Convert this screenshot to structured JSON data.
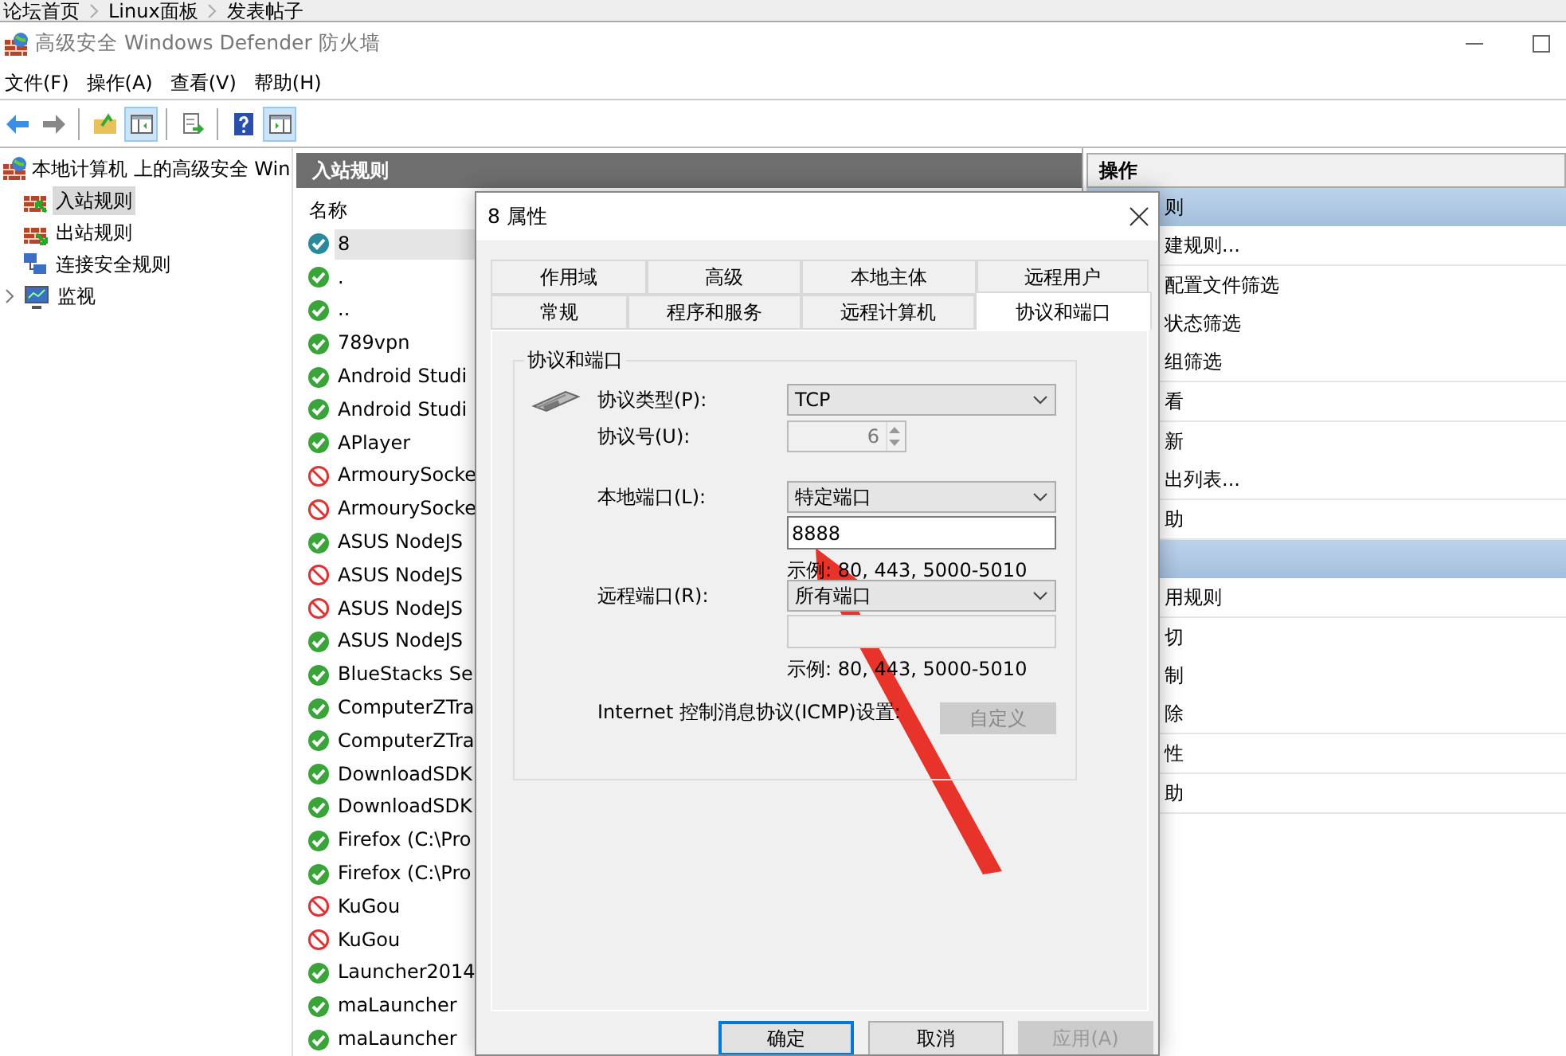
{
  "breadcrumb": [
    "论坛首页",
    "Linux面板",
    "发表帖子"
  ],
  "window": {
    "title": "高级安全 Windows Defender 防火墙"
  },
  "menu": [
    "文件(F)",
    "操作(A)",
    "查看(V)",
    "帮助(H)"
  ],
  "toolbar": [
    {
      "kind": "back",
      "pressed": false
    },
    {
      "kind": "forward",
      "pressed": false
    },
    {
      "kind": "sep"
    },
    {
      "kind": "up",
      "pressed": false
    },
    {
      "kind": "tree",
      "pressed": true
    },
    {
      "kind": "sep"
    },
    {
      "kind": "export",
      "pressed": false
    },
    {
      "kind": "sep"
    },
    {
      "kind": "help",
      "pressed": false
    },
    {
      "kind": "pane",
      "pressed": true
    }
  ],
  "tree": {
    "label": "本地计算机 上的高级安全 Win",
    "children": [
      {
        "label": "入站规则",
        "kind": "inbound",
        "selected": true
      },
      {
        "label": "出站规则",
        "kind": "outbound",
        "selected": false
      },
      {
        "label": "连接安全规则",
        "kind": "connection",
        "selected": false
      },
      {
        "label": "监视",
        "kind": "monitor",
        "selected": false,
        "expandable": true
      }
    ]
  },
  "rules_panel": {
    "title": "入站规则",
    "column": "名称",
    "rows": [
      {
        "name": "8",
        "kind": "allow",
        "selected": true
      },
      {
        "name": ".",
        "kind": "allow",
        "selected": false
      },
      {
        "name": "..",
        "kind": "allow",
        "selected": false
      },
      {
        "name": "789vpn",
        "kind": "allow",
        "selected": false
      },
      {
        "name": "Android Studi",
        "kind": "allow",
        "selected": false
      },
      {
        "name": "Android Studi",
        "kind": "allow",
        "selected": false
      },
      {
        "name": "APlayer",
        "kind": "allow",
        "selected": false
      },
      {
        "name": "ArmourySocke",
        "kind": "block",
        "selected": false
      },
      {
        "name": "ArmourySocke",
        "kind": "block",
        "selected": false
      },
      {
        "name": "ASUS NodeJS",
        "kind": "allow",
        "selected": false
      },
      {
        "name": "ASUS NodeJS",
        "kind": "block",
        "selected": false
      },
      {
        "name": "ASUS NodeJS",
        "kind": "block",
        "selected": false
      },
      {
        "name": "ASUS NodeJS",
        "kind": "allow",
        "selected": false
      },
      {
        "name": "BlueStacks Se",
        "kind": "allow",
        "selected": false
      },
      {
        "name": "ComputerZTra",
        "kind": "allow",
        "selected": false
      },
      {
        "name": "ComputerZTra",
        "kind": "allow",
        "selected": false
      },
      {
        "name": "DownloadSDK",
        "kind": "allow",
        "selected": false
      },
      {
        "name": "DownloadSDK",
        "kind": "allow",
        "selected": false
      },
      {
        "name": "Firefox (C:\\Pro",
        "kind": "allow",
        "selected": false
      },
      {
        "name": "Firefox (C:\\Pro",
        "kind": "allow",
        "selected": false
      },
      {
        "name": "KuGou",
        "kind": "block",
        "selected": false
      },
      {
        "name": "KuGou",
        "kind": "block",
        "selected": false
      },
      {
        "name": "Launcher2014",
        "kind": "allow",
        "selected": false
      },
      {
        "name": "maLauncher",
        "kind": "allow",
        "selected": false
      },
      {
        "name": "maLauncher",
        "kind": "allow",
        "selected": false
      }
    ]
  },
  "actions_panel": {
    "title": "操作",
    "sections": [
      {
        "header": "则",
        "groups": [
          [
            "建规则..."
          ],
          [
            "配置文件筛选",
            "状态筛选",
            "组筛选"
          ],
          [
            "看"
          ],
          [
            "新",
            "出列表..."
          ],
          [
            "助"
          ]
        ]
      },
      {
        "groups": [
          [
            "用规则"
          ],
          [
            "切",
            "制",
            "除"
          ],
          [
            "性"
          ],
          [
            "助"
          ]
        ]
      }
    ]
  },
  "dialog": {
    "title": "8 属性",
    "tab_rows": [
      [
        {
          "label": "作用域",
          "selected": false
        },
        {
          "label": "高级",
          "selected": false
        },
        {
          "label": "本地主体",
          "selected": false
        },
        {
          "label": "远程用户",
          "selected": false
        }
      ],
      [
        {
          "label": "常规",
          "selected": false
        },
        {
          "label": "程序和服务",
          "selected": false
        },
        {
          "label": "远程计算机",
          "selected": false
        },
        {
          "label": "协议和端口",
          "selected": true
        }
      ]
    ],
    "group_title": "协议和端口",
    "protocol_type": {
      "label": "协议类型(P):",
      "value": "TCP"
    },
    "protocol_number": {
      "label": "协议号(U):",
      "value": "6",
      "disabled": true
    },
    "local_port": {
      "label": "本地端口(L):",
      "value": "特定端口",
      "input": "8888",
      "example": "示例: 80, 443, 5000-5010"
    },
    "remote_port": {
      "label": "远程端口(R):",
      "value": "所有端口",
      "input_disabled": true,
      "example": "示例: 80, 443, 5000-5010"
    },
    "icmp": {
      "label": "Internet 控制消息协议(ICMP)设置:",
      "button": "自定义",
      "disabled": true
    },
    "buttons": [
      {
        "label": "确定",
        "default": true,
        "disabled": false
      },
      {
        "label": "取消",
        "default": false,
        "disabled": false
      },
      {
        "label": "应用(A)",
        "default": false,
        "disabled": true
      }
    ]
  }
}
